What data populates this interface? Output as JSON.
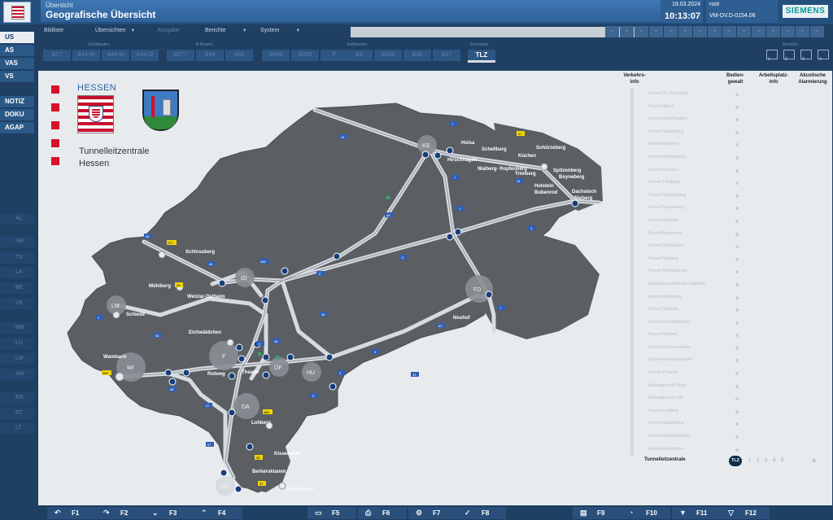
{
  "header": {
    "overview_label": "Übersicht",
    "title": "Geografische Übersicht",
    "date": "19.03.2024",
    "time": "10:13:07",
    "user": "root",
    "host": "VM-DV.D-0154.06",
    "brand": "SIEMENS"
  },
  "menu": {
    "items": [
      "Bildliste",
      "Übersichten",
      "Ausgabe",
      "Berichte",
      "System"
    ],
    "disabled": [
      "Ausgabe"
    ]
  },
  "road_groups": {
    "Großbauten": "Großbauten",
    "B-Bauten": "B-Bauten",
    "Südhessen": "Südhessen",
    "Exchange": "Exchange",
    "Ansichts": "Ansichts"
  },
  "road_buttons": [
    "B27",
    "A44-W",
    "A44-M",
    "A44-O",
    "B277",
    "B49",
    "A66",
    "B455",
    "B250",
    "F",
    "A3",
    "B426",
    "B38",
    "B37"
  ],
  "tlz_button": "TLZ",
  "view_icons": [
    "1",
    "2",
    "3",
    "4"
  ],
  "nav": {
    "primary": [
      "US",
      "AS",
      "VAS",
      "VS"
    ],
    "secondary": [
      "NOTIZ",
      "DOKU",
      "AGAP"
    ],
    "dim": [
      "AL",
      "NR",
      "TV",
      "LA",
      "BE",
      "VK",
      "BM",
      "LU",
      "LW",
      "AW",
      "EN",
      "BT",
      "LT"
    ]
  },
  "branding": {
    "state": "HESSEN",
    "center_line1": "Tunnelleitzentrale",
    "center_line2": "Hessen"
  },
  "right_panel": {
    "headers": [
      "Verkehrs-\ninfo",
      "Bedien-\ngewalt",
      "Arbeitsplatz-\ninfo",
      "Akustische\nAlarmierung"
    ],
    "tunnels": [
      "Tunnel St. Bornberg",
      "Tunnel Hainz",
      "Tunnel Hirschhagen",
      "Tunnel Schellberg",
      "Tunnel Walberg",
      "Tunnel Ropfenberg",
      "Tunnel Küchen",
      "Tunnel Trimberg",
      "Tunnel Spitzenberg",
      "Tunnel Boyneberg",
      "Tunnel Holstein",
      "Tunnel Bubenrod",
      "Tunnel Dachsloch",
      "Tunnel Nieberg",
      "Tunnel Schlossberg",
      "Einhausung Wetzlar-Dalheim",
      "Tunnel Mühlberg",
      "Tunnel Schiede",
      "Tunnel Eichwäldchen",
      "Tunnel Neuhof",
      "Tunnel Eschenweiher",
      "Tunnel Hermannshöhe",
      "Tunnel Theater",
      "Rotwegtunnel West",
      "Rotwegtunnel Ost",
      "Tunnel Lohberg",
      "Tunnel Kisselhöhe",
      "Tunnel Berkersklamm",
      "Tunnel Hirschhorn"
    ],
    "tlz_label": "Tunnelleitzentrale",
    "tlz_badge": "TLZ",
    "pages": [
      "1",
      "2",
      "3",
      "4",
      "5"
    ]
  },
  "map": {
    "city_labels": [
      "KS",
      "GI",
      "FD",
      "LM",
      "WI",
      "F",
      "OF",
      "HU",
      "DA",
      "HD"
    ],
    "tunnel_labels": [
      "Hoisa",
      "Schellberg",
      "Küchen",
      "Schürzeberg",
      "Hirschhagen",
      "Walberg-\nRopfenberg",
      "Trimberg",
      "Spitzenberg",
      "Boyneberg",
      "Holstein",
      "Bubenrod",
      "Dachsloch",
      "Nieberg",
      "Schlossberg",
      "Mühlberg",
      "Wetzlar-Dalheim",
      "Schiede",
      "Eichwäldchen",
      "Neuhof",
      "Wambach",
      "Rotweg",
      "Theater",
      "Lohberg",
      "Kisselhöbe",
      "Berkersklamm",
      "Hirschhorn"
    ],
    "road_numbers": [
      "44",
      "7",
      "7",
      "44",
      "49",
      "7",
      "4",
      "45",
      "485",
      "5",
      "5",
      "66",
      "45",
      "3",
      "66",
      "3",
      "3",
      "60",
      "67",
      "5",
      "67",
      "45",
      "66",
      "3",
      "7",
      "49",
      "27",
      "277",
      "49",
      "260",
      "456",
      "38",
      "37"
    ]
  },
  "fkeys": [
    {
      "icon": "undo-arrow-icon",
      "label": "F1"
    },
    {
      "icon": "redo-arrow-icon",
      "label": "F2"
    },
    {
      "icon": "chevron-down-icon",
      "label": "F3"
    },
    {
      "icon": "chevron-up-icon",
      "label": "F4"
    },
    {
      "icon": "book-icon",
      "label": "F5"
    },
    {
      "icon": "printer-icon",
      "label": "F6"
    },
    {
      "icon": "gear-icon",
      "label": "F7"
    },
    {
      "icon": "checkmark-icon",
      "label": "F8"
    },
    {
      "icon": "display-icon",
      "label": "F9"
    },
    {
      "icon": "bell-icon",
      "label": "F10"
    },
    {
      "icon": "filter-icon",
      "label": "F11"
    },
    {
      "icon": "alarm-icon",
      "label": "F12"
    }
  ],
  "colors": {
    "background": "#1f3f63",
    "map_land": "#5b5e63",
    "road": "#d6dbe0",
    "node": "#173f7a",
    "accent_red": "#d8102a"
  }
}
